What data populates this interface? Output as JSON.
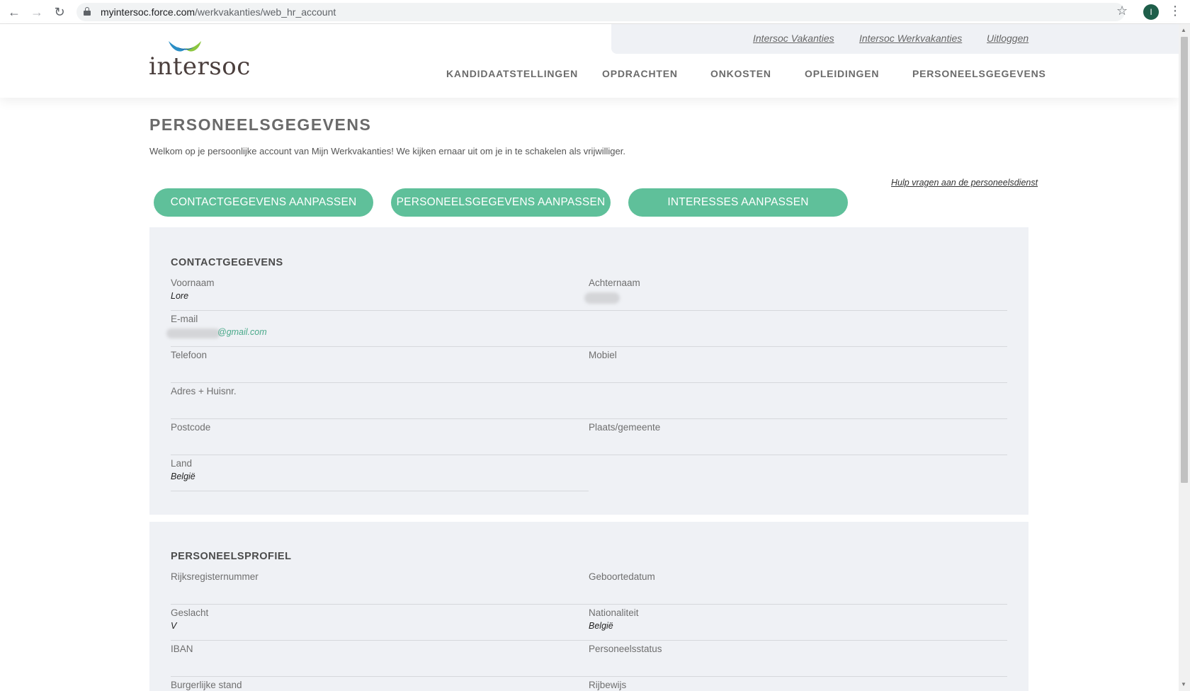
{
  "browser": {
    "url_host": "myintersoc.force.com",
    "url_path": "/werkvakanties/web_hr_account",
    "profile_initial": "I"
  },
  "header": {
    "toplinks": [
      "Intersoc Vakanties",
      "Intersoc Werkvakanties",
      "Uitloggen"
    ],
    "logo_text": "intersoc",
    "nav": [
      "KANDIDAATSTELLINGEN",
      "OPDRACHTEN",
      "ONKOSTEN",
      "OPLEIDINGEN",
      "PERSONEELSGEGEVENS"
    ]
  },
  "page": {
    "title": "PERSONEELSGEGEVENS",
    "intro": "Welkom op je persoonlijke account van Mijn Werkvakanties! We kijken ernaar uit om je in te schakelen als vrijwilliger.",
    "help_link": "Hulp vragen aan de personeelsdienst",
    "buttons": [
      "CONTACTGEGEVENS AANPASSEN",
      "PERSONEELSGEGEVENS AANPASSEN",
      "INTERESSES AANPASSEN"
    ]
  },
  "contact": {
    "title": "CONTACTGEGEVENS",
    "voornaam_label": "Voornaam",
    "voornaam_value": "Lore",
    "achternaam_label": "Achternaam",
    "email_label": "E-mail",
    "email_value": "@gmail.com",
    "telefoon_label": "Telefoon",
    "mobiel_label": "Mobiel",
    "adres_label": "Adres + Huisnr.",
    "postcode_label": "Postcode",
    "plaats_label": "Plaats/gemeente",
    "land_label": "Land",
    "land_value": "België"
  },
  "profile": {
    "title": "PERSONEELSPROFIEL",
    "rijksregister_label": "Rijksregisternummer",
    "geboortedatum_label": "Geboortedatum",
    "geslacht_label": "Geslacht",
    "geslacht_value": "V",
    "nationaliteit_label": "Nationaliteit",
    "nationaliteit_value": "België",
    "iban_label": "IBAN",
    "status_label": "Personeelsstatus",
    "burgerlijke_label": "Burgerlijke stand",
    "rijbewijs_label": "Rijbewijs"
  },
  "colors": {
    "accent": "#5fc09a",
    "card_bg": "#eff1f5",
    "email_text": "#4aa98a"
  }
}
